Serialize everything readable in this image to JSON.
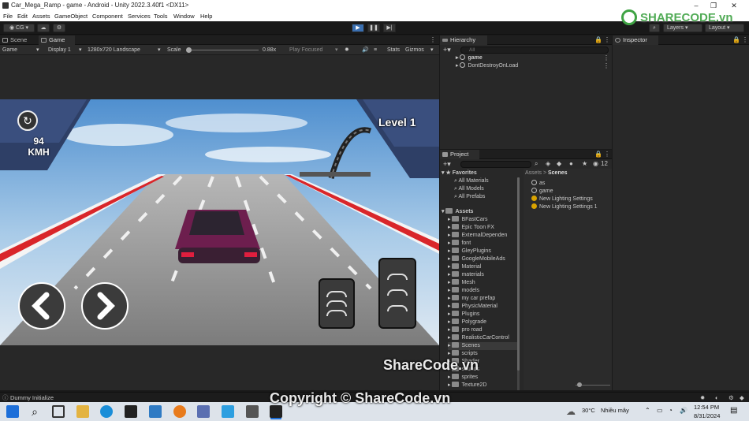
{
  "window": {
    "title": "Car_Mega_Ramp - game - Android - Unity 2022.3.40f1 <DX11>"
  },
  "menu": [
    "File",
    "Edit",
    "Assets",
    "GameObject",
    "Component",
    "Services",
    "Tools",
    "Window",
    "Help"
  ],
  "toolbar": {
    "account": "CG",
    "layers": "Layers",
    "layout": "Layout"
  },
  "scene_tabs": {
    "scene": "Scene",
    "game": "Game"
  },
  "game_bar": {
    "mode": "Game",
    "display": "Display 1",
    "resolution": "1280x720 Landscape",
    "scale_label": "Scale",
    "scale_value": "0.88x",
    "play_focused": "Play Focused",
    "stats": "Stats",
    "gizmos": "Gizmos"
  },
  "hud": {
    "speed_value": "94",
    "speed_unit": "KMH",
    "level": "Level 1"
  },
  "hierarchy": {
    "title": "Hierarchy",
    "search_placeholder": "All",
    "items": [
      "game",
      "DontDestroyOnLoad"
    ]
  },
  "inspector": {
    "title": "Inspector"
  },
  "project": {
    "title": "Project",
    "hidden_count": "12",
    "favorites_label": "Favorites",
    "favorites": [
      "All Materials",
      "All Models",
      "All Prefabs"
    ],
    "assets_label": "Assets",
    "folders": [
      "BFastCars",
      "Epic Toon FX",
      "ExternalDependen",
      "font",
      "GleyPlugins",
      "GoogleMobileAds",
      "Material",
      "materials",
      "Mesh",
      "models",
      "my car prefap",
      "PhysicMaterial",
      "Plugins",
      "Polygrade",
      "pro road",
      "RealisticCarControl",
      "Scenes",
      "scripts",
      "Shader",
      "sounds",
      "sprites",
      "Texture2D"
    ],
    "breadcrumb": [
      "Assets",
      "Scenes"
    ],
    "files": [
      "as",
      "game",
      "New Lighting Settings",
      "New Lighting Settings 1"
    ]
  },
  "status": {
    "message": "Dummy Initialize"
  },
  "taskbar": {
    "weather_temp": "30°C",
    "weather_text": "Nhiều mây",
    "time": "12:54 PM",
    "date": "8/31/2024"
  },
  "watermarks": {
    "logo": "SHARECODE.vn",
    "center": "ShareCode.vn",
    "copyright": "Copyright © ShareCode.vn"
  }
}
